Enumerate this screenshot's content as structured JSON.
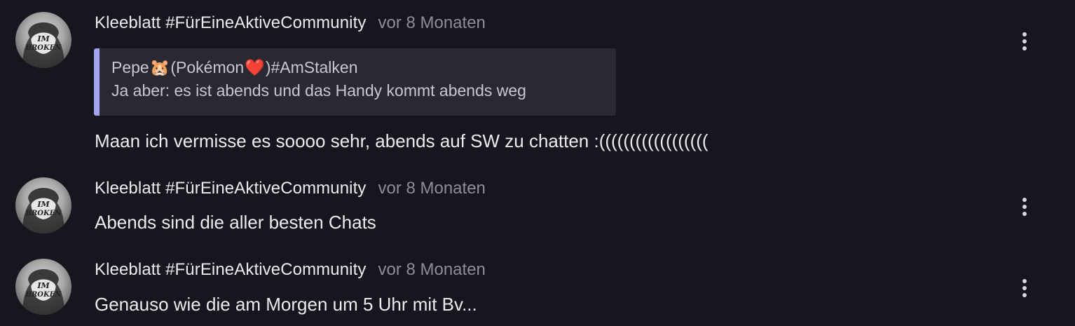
{
  "messages": [
    {
      "author": "Kleeblatt #FürEineAktiveCommunity",
      "time": "vor 8 Monaten",
      "avatar_icon": "anime-avatar-icon",
      "quote": {
        "author_prefix": "Pepe",
        "author_emoji_1": "🐹",
        "author_middle": "(Pokémon ",
        "author_emoji_2": "❤️",
        "author_suffix": ")#AmStalken",
        "text": "Ja aber: es ist abends und das Handy kommt abends weg"
      },
      "text": "Maan ich vermisse es soooo sehr, abends auf SW zu chatten :((((((((((((((((((",
      "menu_icon": "kebab-menu-icon"
    },
    {
      "author": "Kleeblatt #FürEineAktiveCommunity",
      "time": "vor 8 Monaten",
      "avatar_icon": "anime-avatar-icon",
      "text": "Abends sind die aller besten Chats",
      "menu_icon": "kebab-menu-icon"
    },
    {
      "author": "Kleeblatt #FürEineAktiveCommunity",
      "time": "vor 8 Monaten",
      "avatar_icon": "anime-avatar-icon",
      "text": "Genauso wie die am Morgen um 5 Uhr mit Bv...",
      "menu_icon": "kebab-menu-icon"
    }
  ],
  "colors": {
    "background": "#17151d",
    "quote_accent": "#a3a1f0",
    "quote_background": "#2a2830",
    "timestamp": "#8f8d98"
  }
}
